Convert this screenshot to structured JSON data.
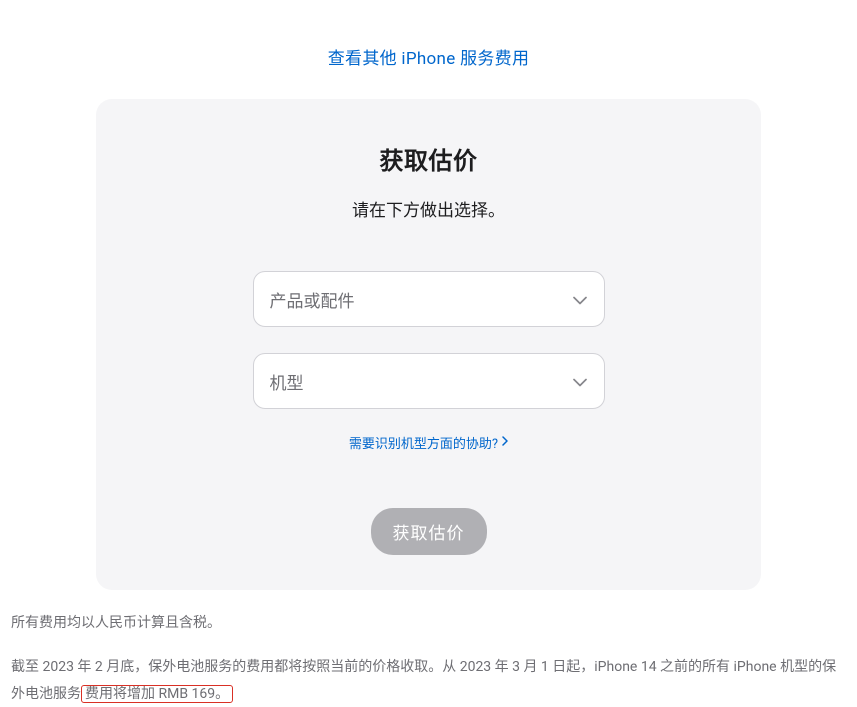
{
  "topLink": {
    "label": "查看其他 iPhone 服务费用"
  },
  "card": {
    "title": "获取估价",
    "subtitle": "请在下方做出选择。",
    "select1": {
      "placeholder": "产品或配件"
    },
    "select2": {
      "placeholder": "机型"
    },
    "helpLink": {
      "label": "需要识别机型方面的协助?"
    },
    "submitButton": {
      "label": "获取估价"
    }
  },
  "footer": {
    "line1": "所有费用均以人民币计算且含税。",
    "line2_part1": "截至 2023 年 2 月底，保外电池服务的费用都将按照当前的价格收取。从 2023 年 3 月 1 日起，iPhone 14 之前的所有 iPhone 机型的保外电池服务",
    "line2_highlight": "费用将增加 RMB 169。"
  }
}
